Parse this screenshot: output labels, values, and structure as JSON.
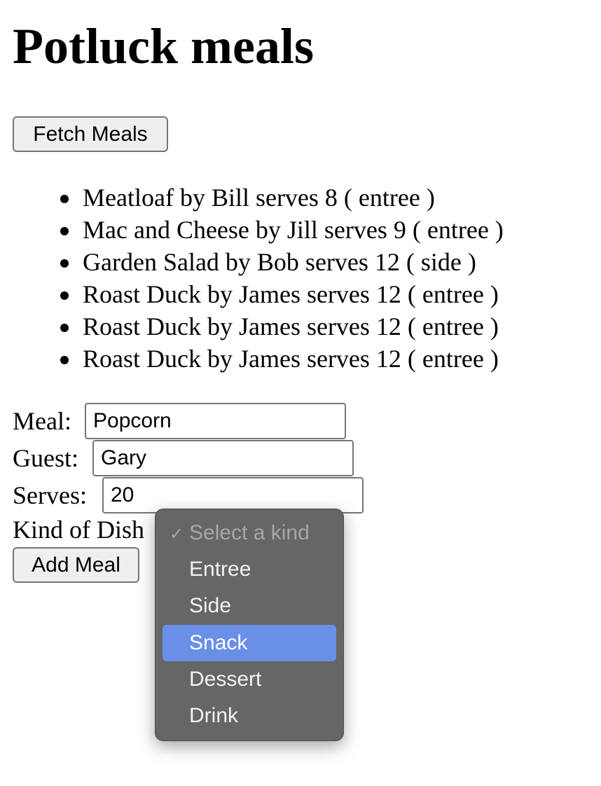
{
  "page": {
    "title": "Potluck meals",
    "fetch_button": "Fetch Meals",
    "add_button": "Add Meal"
  },
  "meals": [
    "Meatloaf by Bill serves 8 ( entree )",
    "Mac and Cheese by Jill serves 9 ( entree )",
    "Garden Salad by Bob serves 12 ( side )",
    "Roast Duck by James serves 12 ( entree )",
    "Roast Duck by James serves 12 ( entree )",
    "Roast Duck by James serves 12 ( entree )"
  ],
  "form": {
    "meal_label": "Meal:",
    "meal_value": "Popcorn",
    "guest_label": "Guest:",
    "guest_value": "Gary",
    "serves_label": "Serves:",
    "serves_value": "20",
    "kind_label": "Kind of Dish"
  },
  "dropdown": {
    "check_glyph": "✓",
    "placeholder": "Select a kind",
    "options": [
      "Entree",
      "Side",
      "Snack",
      "Dessert",
      "Drink"
    ],
    "highlighted": "Snack",
    "highlight_color": "#6a8fe6",
    "menu_color": "#666666"
  }
}
